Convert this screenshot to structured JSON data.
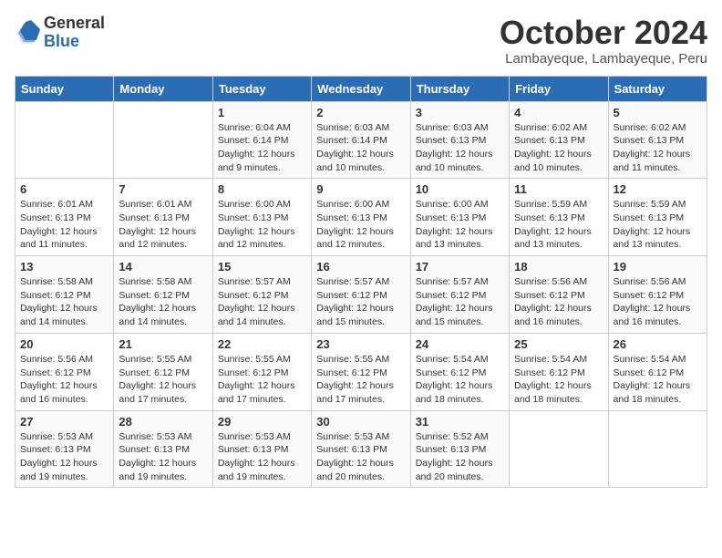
{
  "logo": {
    "general": "General",
    "blue": "Blue"
  },
  "title": "October 2024",
  "subtitle": "Lambayeque, Lambayeque, Peru",
  "headers": [
    "Sunday",
    "Monday",
    "Tuesday",
    "Wednesday",
    "Thursday",
    "Friday",
    "Saturday"
  ],
  "weeks": [
    [
      {
        "day": "",
        "info": ""
      },
      {
        "day": "",
        "info": ""
      },
      {
        "day": "1",
        "info": "Sunrise: 6:04 AM\nSunset: 6:14 PM\nDaylight: 12 hours and 9 minutes."
      },
      {
        "day": "2",
        "info": "Sunrise: 6:03 AM\nSunset: 6:14 PM\nDaylight: 12 hours and 10 minutes."
      },
      {
        "day": "3",
        "info": "Sunrise: 6:03 AM\nSunset: 6:13 PM\nDaylight: 12 hours and 10 minutes."
      },
      {
        "day": "4",
        "info": "Sunrise: 6:02 AM\nSunset: 6:13 PM\nDaylight: 12 hours and 10 minutes."
      },
      {
        "day": "5",
        "info": "Sunrise: 6:02 AM\nSunset: 6:13 PM\nDaylight: 12 hours and 11 minutes."
      }
    ],
    [
      {
        "day": "6",
        "info": "Sunrise: 6:01 AM\nSunset: 6:13 PM\nDaylight: 12 hours and 11 minutes."
      },
      {
        "day": "7",
        "info": "Sunrise: 6:01 AM\nSunset: 6:13 PM\nDaylight: 12 hours and 12 minutes."
      },
      {
        "day": "8",
        "info": "Sunrise: 6:00 AM\nSunset: 6:13 PM\nDaylight: 12 hours and 12 minutes."
      },
      {
        "day": "9",
        "info": "Sunrise: 6:00 AM\nSunset: 6:13 PM\nDaylight: 12 hours and 12 minutes."
      },
      {
        "day": "10",
        "info": "Sunrise: 6:00 AM\nSunset: 6:13 PM\nDaylight: 12 hours and 13 minutes."
      },
      {
        "day": "11",
        "info": "Sunrise: 5:59 AM\nSunset: 6:13 PM\nDaylight: 12 hours and 13 minutes."
      },
      {
        "day": "12",
        "info": "Sunrise: 5:59 AM\nSunset: 6:13 PM\nDaylight: 12 hours and 13 minutes."
      }
    ],
    [
      {
        "day": "13",
        "info": "Sunrise: 5:58 AM\nSunset: 6:12 PM\nDaylight: 12 hours and 14 minutes."
      },
      {
        "day": "14",
        "info": "Sunrise: 5:58 AM\nSunset: 6:12 PM\nDaylight: 12 hours and 14 minutes."
      },
      {
        "day": "15",
        "info": "Sunrise: 5:57 AM\nSunset: 6:12 PM\nDaylight: 12 hours and 14 minutes."
      },
      {
        "day": "16",
        "info": "Sunrise: 5:57 AM\nSunset: 6:12 PM\nDaylight: 12 hours and 15 minutes."
      },
      {
        "day": "17",
        "info": "Sunrise: 5:57 AM\nSunset: 6:12 PM\nDaylight: 12 hours and 15 minutes."
      },
      {
        "day": "18",
        "info": "Sunrise: 5:56 AM\nSunset: 6:12 PM\nDaylight: 12 hours and 16 minutes."
      },
      {
        "day": "19",
        "info": "Sunrise: 5:56 AM\nSunset: 6:12 PM\nDaylight: 12 hours and 16 minutes."
      }
    ],
    [
      {
        "day": "20",
        "info": "Sunrise: 5:56 AM\nSunset: 6:12 PM\nDaylight: 12 hours and 16 minutes."
      },
      {
        "day": "21",
        "info": "Sunrise: 5:55 AM\nSunset: 6:12 PM\nDaylight: 12 hours and 17 minutes."
      },
      {
        "day": "22",
        "info": "Sunrise: 5:55 AM\nSunset: 6:12 PM\nDaylight: 12 hours and 17 minutes."
      },
      {
        "day": "23",
        "info": "Sunrise: 5:55 AM\nSunset: 6:12 PM\nDaylight: 12 hours and 17 minutes."
      },
      {
        "day": "24",
        "info": "Sunrise: 5:54 AM\nSunset: 6:12 PM\nDaylight: 12 hours and 18 minutes."
      },
      {
        "day": "25",
        "info": "Sunrise: 5:54 AM\nSunset: 6:12 PM\nDaylight: 12 hours and 18 minutes."
      },
      {
        "day": "26",
        "info": "Sunrise: 5:54 AM\nSunset: 6:12 PM\nDaylight: 12 hours and 18 minutes."
      }
    ],
    [
      {
        "day": "27",
        "info": "Sunrise: 5:53 AM\nSunset: 6:13 PM\nDaylight: 12 hours and 19 minutes."
      },
      {
        "day": "28",
        "info": "Sunrise: 5:53 AM\nSunset: 6:13 PM\nDaylight: 12 hours and 19 minutes."
      },
      {
        "day": "29",
        "info": "Sunrise: 5:53 AM\nSunset: 6:13 PM\nDaylight: 12 hours and 19 minutes."
      },
      {
        "day": "30",
        "info": "Sunrise: 5:53 AM\nSunset: 6:13 PM\nDaylight: 12 hours and 20 minutes."
      },
      {
        "day": "31",
        "info": "Sunrise: 5:52 AM\nSunset: 6:13 PM\nDaylight: 12 hours and 20 minutes."
      },
      {
        "day": "",
        "info": ""
      },
      {
        "day": "",
        "info": ""
      }
    ]
  ]
}
